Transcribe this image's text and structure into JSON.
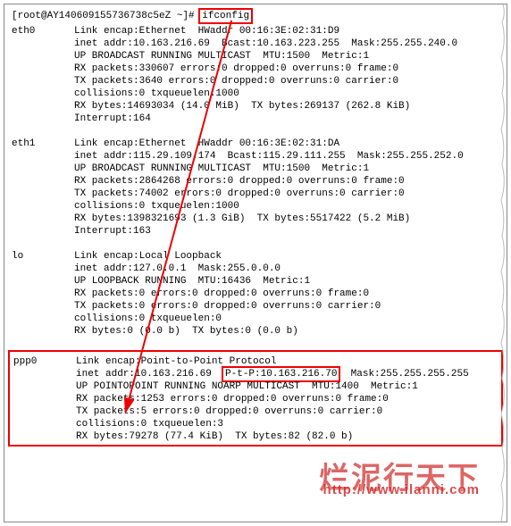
{
  "prompt": {
    "prefix": "[root@AY140609155736738c5eZ ~]#",
    "command": "ifconfig"
  },
  "eth0": {
    "name": "eth0",
    "l1": "Link encap:Ethernet  HWaddr 00:16:3E:02:31:D9",
    "l2": "inet addr:10.163.216.69  Bcast:10.163.223.255  Mask:255.255.240.0",
    "l3": "UP BROADCAST RUNNING MULTICAST  MTU:1500  Metric:1",
    "l4": "RX packets:330607 errors:0 dropped:0 overruns:0 frame:0",
    "l5": "TX packets:3640 errors:0 dropped:0 overruns:0 carrier:0",
    "l6": "collisions:0 txqueuelen:1000",
    "l7": "RX bytes:14693034 (14.0 MiB)  TX bytes:269137 (262.8 KiB)",
    "l8": "Interrupt:164"
  },
  "eth1": {
    "name": "eth1",
    "l1": "Link encap:Ethernet  HWaddr 00:16:3E:02:31:DA",
    "l2": "inet addr:115.29.109.174  Bcast:115.29.111.255  Mask:255.255.252.0",
    "l3": "UP BROADCAST RUNNING MULTICAST  MTU:1500  Metric:1",
    "l4": "RX packets:2864268 errors:0 dropped:0 overruns:0 frame:0",
    "l5": "TX packets:74002 errors:0 dropped:0 overruns:0 carrier:0",
    "l6": "collisions:0 txqueuelen:1000",
    "l7": "RX bytes:1398321693 (1.3 GiB)  TX bytes:5517422 (5.2 MiB)",
    "l8": "Interrupt:163"
  },
  "lo": {
    "name": "lo",
    "l1": "Link encap:Local Loopback",
    "l2": "inet addr:127.0.0.1  Mask:255.0.0.0",
    "l3": "UP LOOPBACK RUNNING  MTU:16436  Metric:1",
    "l4": "RX packets:0 errors:0 dropped:0 overruns:0 frame:0",
    "l5": "TX packets:0 errors:0 dropped:0 overruns:0 carrier:0",
    "l6": "collisions:0 txqueuelen:0",
    "l7": "RX bytes:0 (0.0 b)  TX bytes:0 (0.0 b)"
  },
  "ppp0": {
    "name": "ppp0",
    "l1": "Link encap:Point-to-Point Protocol",
    "l2a": "inet addr:10.163.216.69  ",
    "l2b": "P-t-P:10.163.216.70",
    "l2c": "  Mask:255.255.255.255",
    "l3": "UP POINTOPOINT RUNNING NOARP MULTICAST  MTU:1400  Metric:1",
    "l4": "RX packets:1253 errors:0 dropped:0 overruns:0 frame:0",
    "l5": "TX packets:5 errors:0 dropped:0 overruns:0 carrier:0",
    "l6": "collisions:0 txqueuelen:3",
    "l7": "RX bytes:79278 (77.4 KiB)  TX bytes:82 (82.0 b)"
  },
  "watermark": {
    "text": "烂泥行天下",
    "url": "http://www.ilanni.com"
  }
}
